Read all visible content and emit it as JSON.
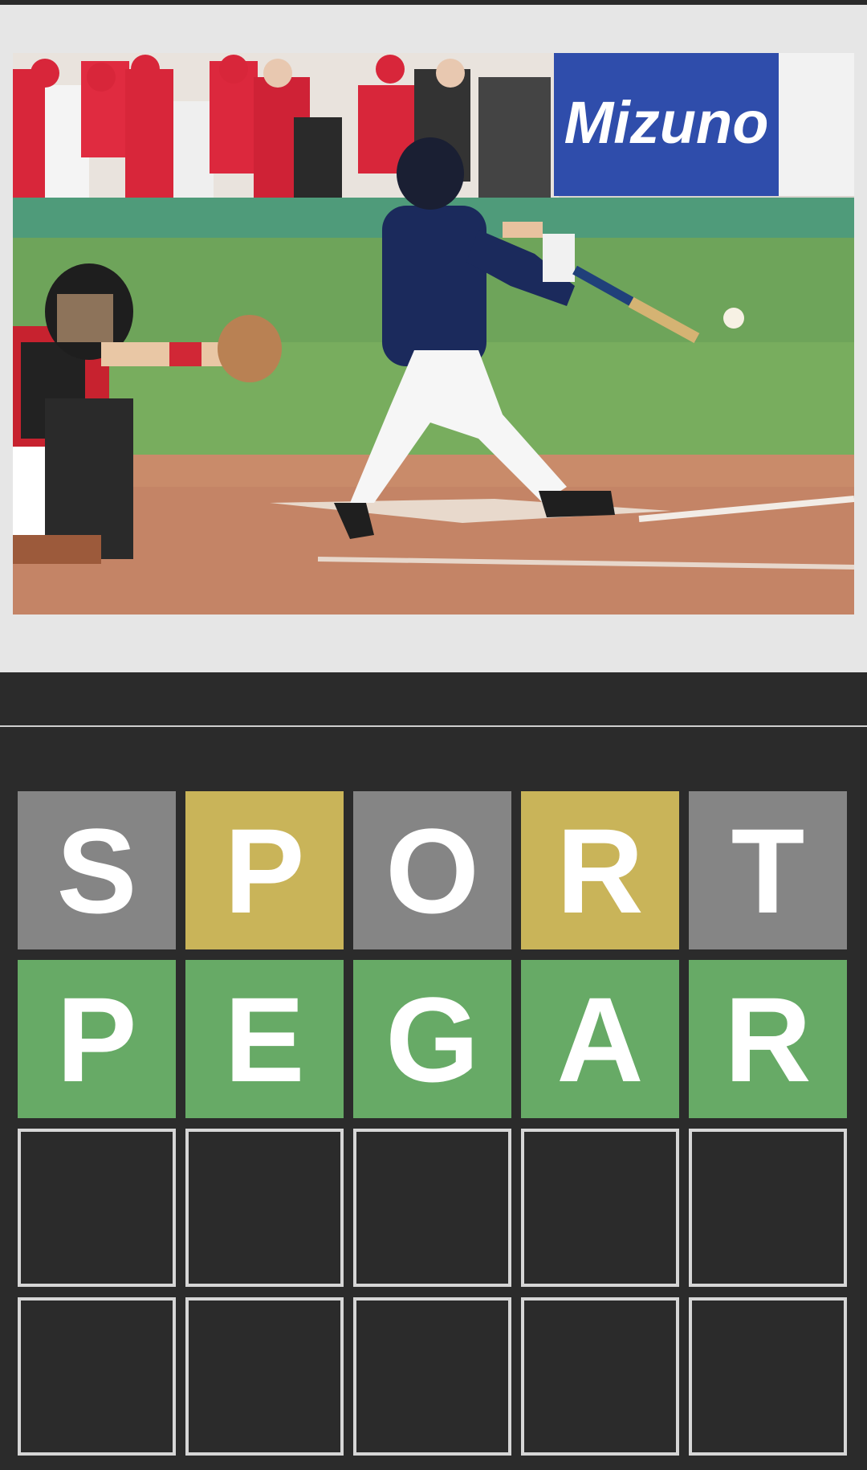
{
  "colors": {
    "background": "#2b2b2b",
    "image_panel": "#e6e6e6",
    "absent": "#858585",
    "present": "#c9b459",
    "correct": "#67aa66",
    "empty_border": "#d6d6d6",
    "letter": "#ffffff"
  },
  "photo": {
    "banner_text": "Mizuno"
  },
  "board": {
    "rows": [
      {
        "tiles": [
          {
            "letter": "S",
            "state": "absent"
          },
          {
            "letter": "P",
            "state": "present"
          },
          {
            "letter": "O",
            "state": "absent"
          },
          {
            "letter": "R",
            "state": "present"
          },
          {
            "letter": "T",
            "state": "absent"
          }
        ]
      },
      {
        "tiles": [
          {
            "letter": "P",
            "state": "correct"
          },
          {
            "letter": "E",
            "state": "correct"
          },
          {
            "letter": "G",
            "state": "correct"
          },
          {
            "letter": "A",
            "state": "correct"
          },
          {
            "letter": "R",
            "state": "correct"
          }
        ]
      },
      {
        "tiles": [
          {
            "letter": "",
            "state": "empty"
          },
          {
            "letter": "",
            "state": "empty"
          },
          {
            "letter": "",
            "state": "empty"
          },
          {
            "letter": "",
            "state": "empty"
          },
          {
            "letter": "",
            "state": "empty"
          }
        ]
      },
      {
        "tiles": [
          {
            "letter": "",
            "state": "empty"
          },
          {
            "letter": "",
            "state": "empty"
          },
          {
            "letter": "",
            "state": "empty"
          },
          {
            "letter": "",
            "state": "empty"
          },
          {
            "letter": "",
            "state": "empty"
          }
        ]
      }
    ]
  }
}
